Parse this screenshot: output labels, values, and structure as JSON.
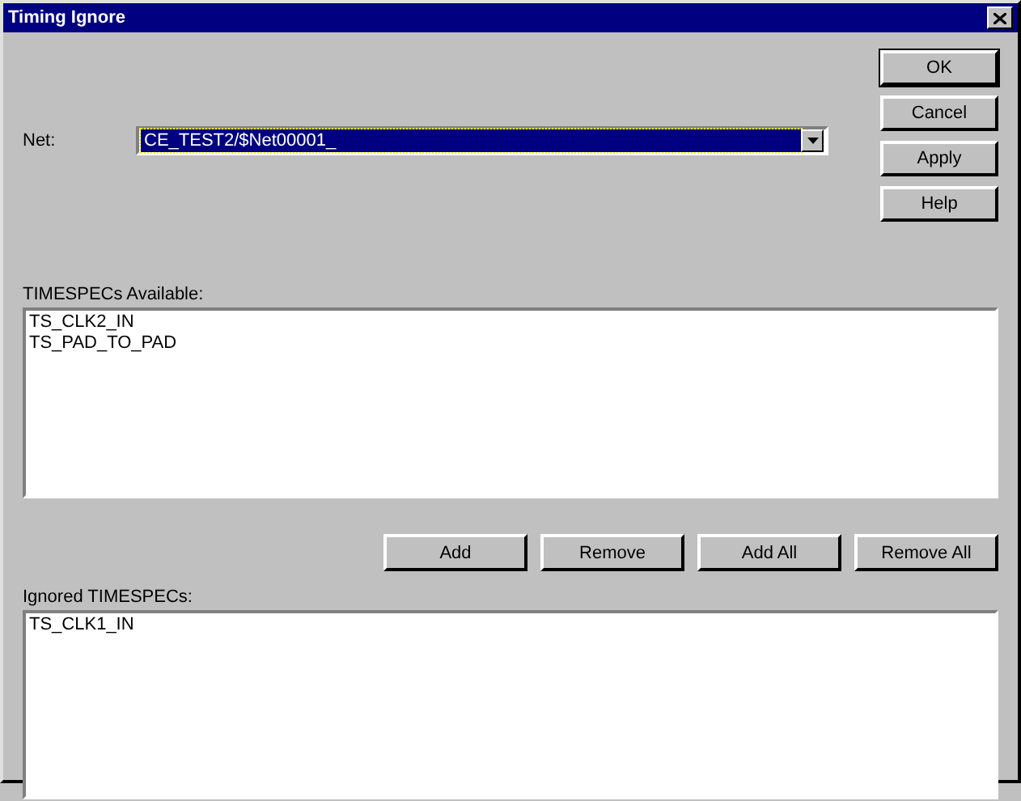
{
  "window": {
    "title": "Timing Ignore"
  },
  "net": {
    "label": "Net:",
    "value": "CE_TEST2/$Net00001_",
    "selected": true
  },
  "dialog_buttons": [
    {
      "label": "OK",
      "default": true
    },
    {
      "label": "Cancel",
      "default": false
    },
    {
      "label": "Apply",
      "default": false
    },
    {
      "label": "Help",
      "default": false
    }
  ],
  "available": {
    "label": "TIMESPECs Available:",
    "items": [
      "TS_CLK2_IN",
      "TS_PAD_TO_PAD"
    ]
  },
  "move_buttons": [
    "Add",
    "Remove",
    "Add All",
    "Remove All"
  ],
  "ignored": {
    "label": "Ignored TIMESPECs:",
    "items": [
      "TS_CLK1_IN"
    ]
  }
}
